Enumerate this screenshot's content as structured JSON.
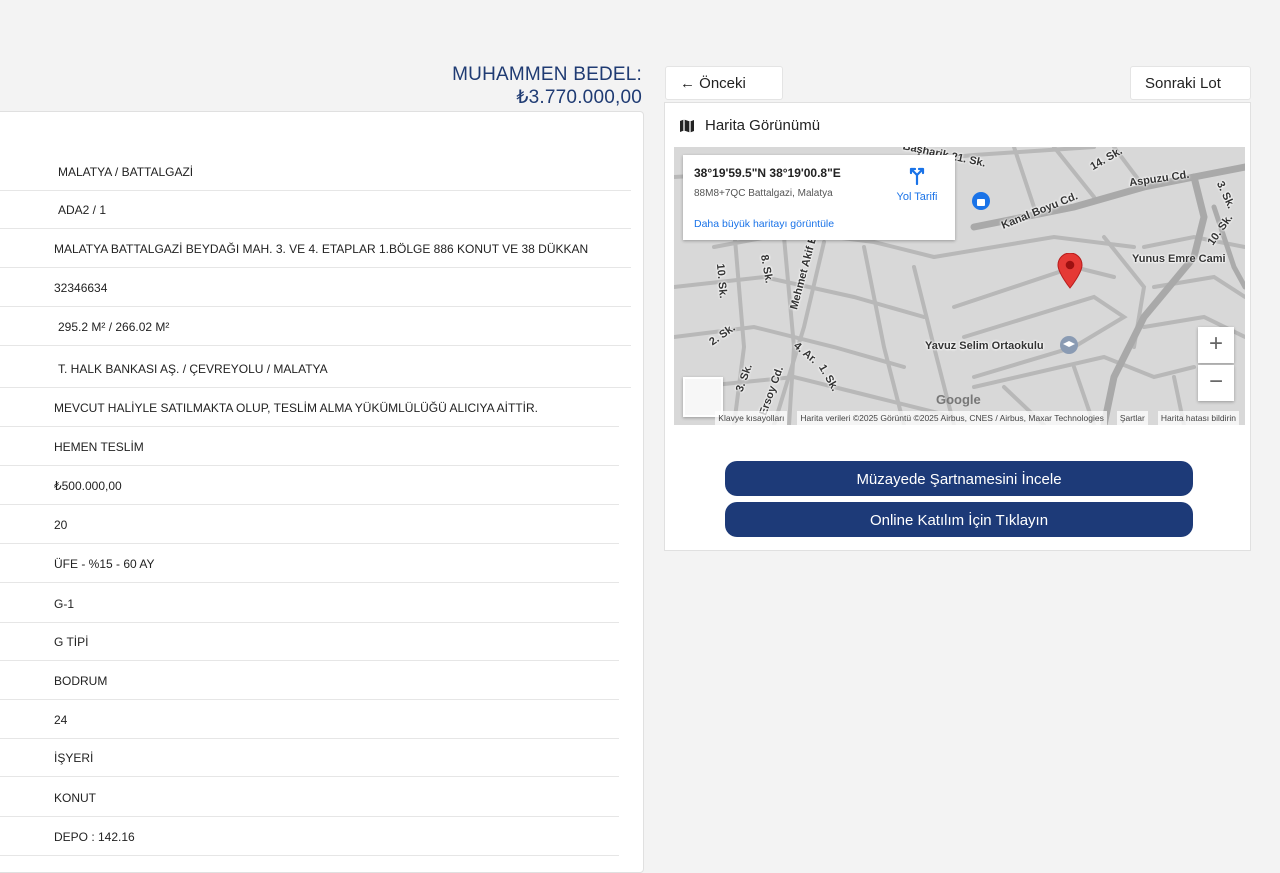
{
  "header": {
    "price": "MUHAMMEN BEDEL: ₺3.770.000,00"
  },
  "details": {
    "rows": [
      " MALATYA / BATTALGAZİ",
      " ADA2 / 1",
      "MALATYA BATTALGAZİ BEYDAĞI MAH. 3. VE 4. ETAPLAR 1.BÖLGE 886 KONUT VE 38 DÜKKAN",
      "32346634",
      " 295.2 M² / 266.02 M²",
      " T. HALK BANKASI AŞ. / ÇEVREYOLU / MALATYA",
      "MEVCUT HALİYLE SATILMAKTA OLUP, TESLİM ALMA YÜKÜMLÜLÜĞÜ ALICIYA AİTTİR.",
      "HEMEN TESLİM",
      "₺500.000,00",
      "20",
      "ÜFE - %15 - 60 AY",
      "G-1",
      "G TİPİ",
      "BODRUM",
      "24",
      "İŞYERİ",
      "KONUT",
      "DEPO : 142.16"
    ]
  },
  "nav": {
    "prev": "← Önceki Lot",
    "next": "Sonraki Lot →"
  },
  "map_panel": {
    "title": "Harita Görünümü",
    "coords": "38°19'59.5\"N 38°19'00.8\"E",
    "plus_code": "88M8+7QC Battalgazi, Malatya",
    "larger_map": "Daha büyük haritayı görüntüle",
    "directions": "Yol Tarifi",
    "zoom_in": "+",
    "zoom_out": "−",
    "google": "Google",
    "footer": [
      "Klavye kısayolları",
      "Harita verileri ©2025 Görüntü ©2025 Airbus, CNES / Airbus, Maxar Technologies",
      "Şartlar",
      "Harita hatası bildirin"
    ],
    "labels": [
      "Başharik 21. Sk.",
      "Aspuzu Cd.",
      "Kanal Boyu Cd.",
      "Yunus Emre Cami",
      "Yavuz Selim Ortaokulu",
      "Mehmet Akif E",
      "10. Sk.",
      "8. Sk.",
      "2. Sk.",
      "3. Sk.",
      "4. Ar.",
      "1. Sk.",
      "Ersoy Cd.",
      "14. Sk.",
      "10. Sk.",
      "3. Sk."
    ]
  },
  "actions": {
    "spec": "Müzayede Şartnamesini İncele",
    "online": "Online Katılım İçin Tıklayın"
  },
  "colors": {
    "brand": "#1d3a78",
    "price": "#1f3b73",
    "marker": "#e53935"
  },
  "icons": {
    "map_title": "map-icon",
    "directions": "directions-icon",
    "marker": "map-pin-icon",
    "school": "school-icon"
  }
}
